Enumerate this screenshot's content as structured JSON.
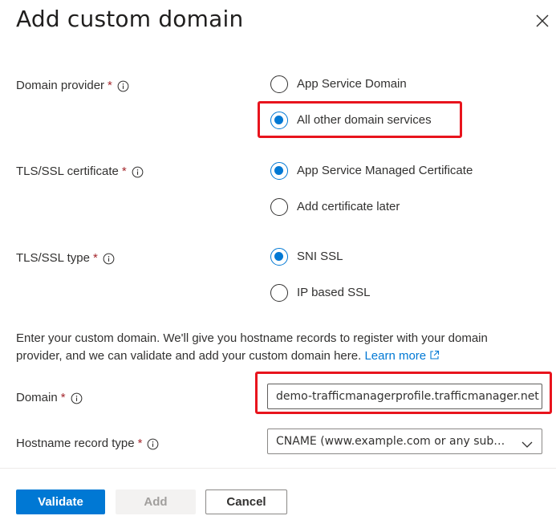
{
  "panel": {
    "title": "Add custom domain",
    "close_label": "Close"
  },
  "domain_provider": {
    "label": "Domain provider",
    "required_mark": "*",
    "options": [
      {
        "label": "App Service Domain",
        "checked": false
      },
      {
        "label": "All other domain services",
        "checked": true
      }
    ]
  },
  "tls_certificate": {
    "label": "TLS/SSL certificate",
    "required_mark": "*",
    "options": [
      {
        "label": "App Service Managed Certificate",
        "checked": true
      },
      {
        "label": "Add certificate later",
        "checked": false
      }
    ]
  },
  "tls_type": {
    "label": "TLS/SSL type",
    "required_mark": "*",
    "options": [
      {
        "label": "SNI SSL",
        "checked": true
      },
      {
        "label": "IP based SSL",
        "checked": false
      }
    ]
  },
  "description": {
    "text": "Enter your custom domain. We'll give you hostname records to register with your domain provider, and we can validate and add your custom domain here.",
    "link": "Learn more"
  },
  "domain": {
    "label": "Domain",
    "required_mark": "*",
    "value": "demo-trafficmanagerprofile.trafficmanager.net"
  },
  "hostname_record_type": {
    "label": "Hostname record type",
    "required_mark": "*",
    "value": "CNAME (www.example.com or any subdomain)"
  },
  "footer": {
    "validate": "Validate",
    "add": "Add",
    "cancel": "Cancel"
  },
  "colors": {
    "accent": "#0078d4",
    "highlight": "#e8141d",
    "required": "#a4262c"
  }
}
